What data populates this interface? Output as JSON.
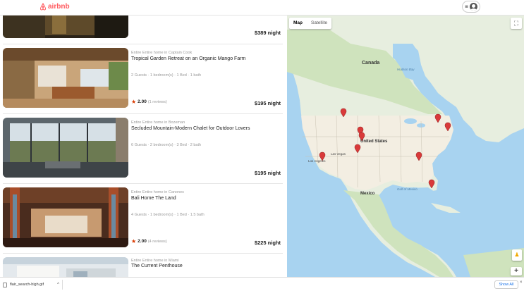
{
  "header": {
    "logo_text": "airbnb",
    "logo_icon": "airbnb-belo-icon",
    "menu_icon": "hamburger-icon",
    "avatar_icon": "user-avatar-icon"
  },
  "listings": [
    {
      "type": "",
      "title": "",
      "meta": "",
      "rating_score": "",
      "rating_count": "",
      "price": "$389 night",
      "image_colors": [
        "#2e2418",
        "#6b5a2e"
      ]
    },
    {
      "type": "Entire Entire home in Captain Cook",
      "title": "Tropical Garden Retreat on an Organic Mango Farm",
      "meta": "2 Guests · 1 bedroom(s) · 1 Bed · 1 bath",
      "rating_score": "2.00",
      "rating_count": "(1 reviews)",
      "price": "$195 night",
      "image_colors": [
        "#b88a5a",
        "#e7d7c1"
      ]
    },
    {
      "type": "Entire Entire home in Bozeman",
      "title": "Secluded Mountain-Modern Chalet for Outdoor Lovers",
      "meta": "6 Guests · 2 bedroom(s) · 3 Bed · 2 bath",
      "rating_score": "",
      "rating_count": "",
      "price": "$195 night",
      "image_colors": [
        "#6f7c86",
        "#c9d2d8"
      ]
    },
    {
      "type": "Entire Entire home in Canones",
      "title": "Bali Home The Land",
      "meta": "4 Guests · 1 bedroom(s) · 1 Bed · 1.5 bath",
      "rating_score": "2.00",
      "rating_count": "(4 reviews)",
      "price": "$225 night",
      "image_colors": [
        "#5a3626",
        "#a86a44"
      ]
    },
    {
      "type": "Entire Entire home in Miami",
      "title": "The Current Penthouse",
      "meta": "",
      "rating_score": "",
      "rating_count": "",
      "price": "",
      "image_colors": [
        "#d7dde2",
        "#f2f2f2"
      ]
    }
  ],
  "map": {
    "tabs": [
      "Map",
      "Satellite"
    ],
    "active_tab": "Map",
    "labels": {
      "canada": "Canada",
      "united_states": "United States",
      "mexico": "Mexico",
      "las_vegas": "Las Vegas",
      "los_angeles": "Los Angeles",
      "gulf_of_mexico": "Gulf of Mexico",
      "hudson_bay": "Hudson Bay"
    },
    "colors": {
      "water": "#a8d3f0",
      "land": "#e8eedf",
      "green": "#c7ddb4",
      "us_land": "#f1ece0",
      "marker": "#d93a3a"
    },
    "marker_count": 9,
    "fullscreen_icon": "fullscreen-icon",
    "zoom_in_label": "+",
    "pegman_icon": "pegman-icon"
  },
  "downloads": {
    "file_name": "flair_search-high.gif",
    "show_all_label": "Show All",
    "close_label": "×"
  }
}
